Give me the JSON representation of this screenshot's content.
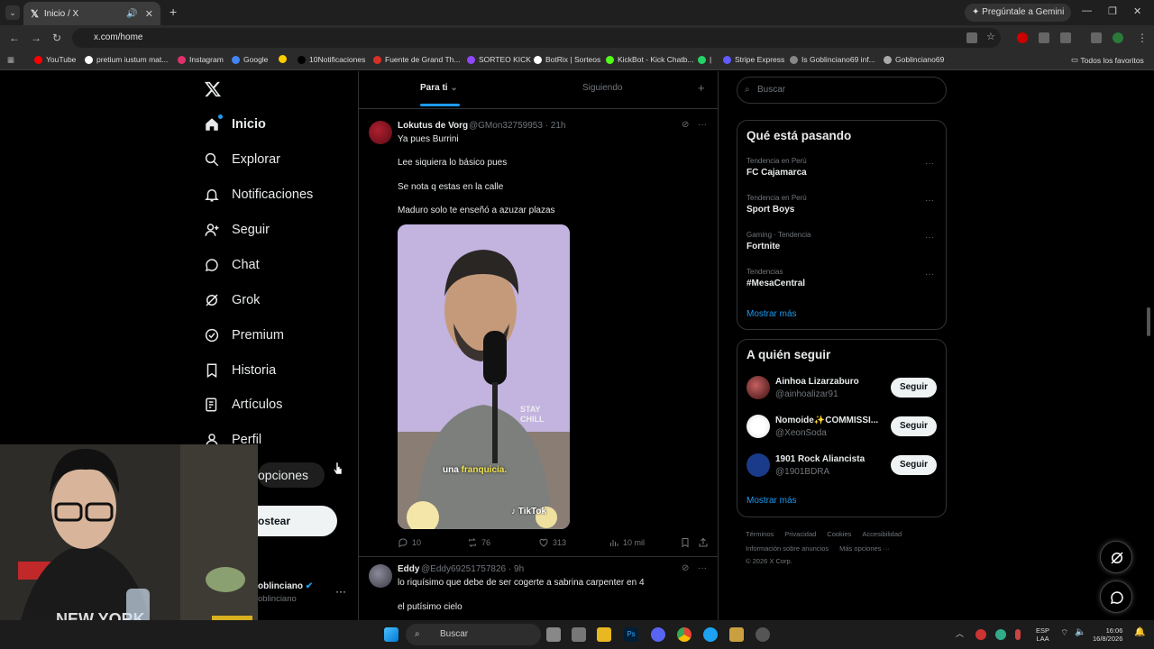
{
  "browser": {
    "tab_title": "Inicio / X",
    "gemini_label": "Pregúntale a Gemini",
    "url": "x.com/home",
    "bookmarks": [
      {
        "label": "YouTube",
        "color": "#ff0000"
      },
      {
        "label": "pretium iustum mat...",
        "color": "#ffffff"
      },
      {
        "label": "Instagram",
        "color": "#e1306c"
      },
      {
        "label": "Google",
        "color": "#4285f4"
      },
      {
        "label": "",
        "color": "#ffcc00"
      },
      {
        "label": "10Notificaciones",
        "color": "#000000"
      },
      {
        "label": "Fuente de Grand Th...",
        "color": "#d93025"
      },
      {
        "label": "SORTEO KICK",
        "color": "#9146ff"
      },
      {
        "label": "BotRix | Sorteos",
        "color": "#ffffff"
      },
      {
        "label": "KickBot - Kick Chatb...",
        "color": "#53fc18"
      },
      {
        "label": "|",
        "color": "#25d366"
      },
      {
        "label": "Stripe Express",
        "color": "#635bff"
      },
      {
        "label": "Is Goblinciano69 inf...",
        "color": "#888888"
      },
      {
        "label": "Goblinciano69",
        "color": "#aaaaaa"
      }
    ],
    "all_bookmarks": "Todos los favoritos"
  },
  "nav": {
    "items": [
      {
        "label": "Inicio",
        "icon": "home-icon"
      },
      {
        "label": "Explorar",
        "icon": "search-icon"
      },
      {
        "label": "Notificaciones",
        "icon": "bell-icon"
      },
      {
        "label": "Seguir",
        "icon": "add-user-icon"
      },
      {
        "label": "Chat",
        "icon": "chat-icon"
      },
      {
        "label": "Grok",
        "icon": "grok-icon"
      },
      {
        "label": "Premium",
        "icon": "verified-icon"
      },
      {
        "label": "Historia",
        "icon": "bookmark-icon"
      },
      {
        "label": "Artículos",
        "icon": "article-icon"
      },
      {
        "label": "Perfil",
        "icon": "person-icon"
      }
    ],
    "more_options": "opciones",
    "post_button": "ostear",
    "account_name": "oblinciano",
    "account_handle": "oblinciano"
  },
  "feed": {
    "tabs": {
      "for_you": "Para ti",
      "following": "Siguiendo"
    },
    "tweet1": {
      "name": "Lokutus de Vorg",
      "meta": "@GMon32759953 · 21h",
      "lines": [
        "Ya pues Burrini",
        "Lee siquiera lo básico pues",
        "Se nota q estas en la calle",
        "Maduro solo te enseñó a azuzar plazas"
      ],
      "caption_pre": "una ",
      "caption_hl": "franquicia.",
      "watermark": "TikTok",
      "shirt": "STAY CHILL",
      "replies": "10",
      "reposts": "76",
      "likes": "313",
      "views": "10 mil"
    },
    "tweet2": {
      "name": "Eddy",
      "meta": "@Eddy69251757826 · 9h",
      "lines": [
        "lo riquísimo que debe de ser cogerte a sabrina carpenter en 4",
        "el putísimo cielo"
      ]
    }
  },
  "sidebar": {
    "search_placeholder": "Buscar",
    "trends_title": "Qué está pasando",
    "trends": [
      {
        "category": "Tendencia en Perú",
        "name": "FC Cajamarca"
      },
      {
        "category": "Tendencia en Perú",
        "name": "Sport Boys"
      },
      {
        "category": "Gaming · Tendencia",
        "name": "Fortnite"
      },
      {
        "category": "Tendencias",
        "name": "#MesaCentral"
      }
    ],
    "show_more": "Mostrar más",
    "follow_title": "A quién seguir",
    "follow": [
      {
        "name": "Ainhoa Lizarzaburo",
        "handle": "@ainhoalizar91",
        "button": "Seguir"
      },
      {
        "name": "Ñomoide✨COMMISSI...",
        "handle": "@XeonSoda",
        "button": "Seguir"
      },
      {
        "name": "1901 Rock Aliancista",
        "handle": "@1901BDRA",
        "button": "Seguir"
      }
    ],
    "footer_line1": [
      "Términos",
      "Privacidad",
      "Cookies",
      "Accesibilidad"
    ],
    "footer_line2": [
      "Información sobre anuncios",
      "Más opciones ···"
    ],
    "copyright": "© 2026 X Corp."
  },
  "taskbar": {
    "search": "Buscar",
    "lang_top": "ESP",
    "lang_bottom": "LAA",
    "time": "16:06",
    "date": "16/8/2026"
  }
}
